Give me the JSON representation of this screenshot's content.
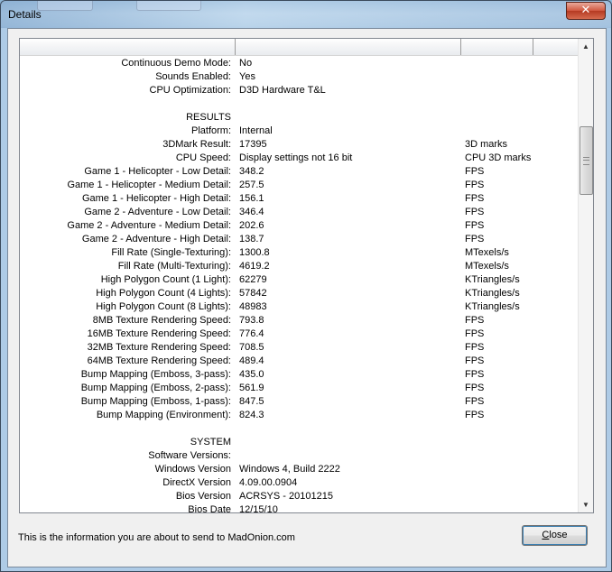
{
  "window": {
    "title": "Details",
    "close_glyph": "✕"
  },
  "list": {
    "rows": [
      {
        "label": "Continuous Demo Mode:",
        "value": "No",
        "unit": ""
      },
      {
        "label": "Sounds Enabled:",
        "value": "Yes",
        "unit": ""
      },
      {
        "label": "CPU Optimization:",
        "value": "D3D Hardware T&L",
        "unit": ""
      },
      {
        "label": "",
        "value": "",
        "unit": ""
      },
      {
        "label": "RESULTS",
        "value": "",
        "unit": ""
      },
      {
        "label": "Platform:",
        "value": "Internal",
        "unit": ""
      },
      {
        "label": "3DMark Result:",
        "value": "17395",
        "unit": "3D marks"
      },
      {
        "label": "CPU Speed:",
        "value": "Display settings not 16 bit",
        "unit": "CPU 3D marks"
      },
      {
        "label": "Game 1 - Helicopter - Low Detail:",
        "value": "348.2",
        "unit": "FPS"
      },
      {
        "label": "Game 1 - Helicopter - Medium Detail:",
        "value": "257.5",
        "unit": "FPS"
      },
      {
        "label": "Game 1 - Helicopter - High Detail:",
        "value": "156.1",
        "unit": "FPS"
      },
      {
        "label": "Game 2 - Adventure - Low Detail:",
        "value": "346.4",
        "unit": "FPS"
      },
      {
        "label": "Game 2 - Adventure - Medium Detail:",
        "value": "202.6",
        "unit": "FPS"
      },
      {
        "label": "Game 2 - Adventure - High Detail:",
        "value": "138.7",
        "unit": "FPS"
      },
      {
        "label": "Fill Rate (Single-Texturing):",
        "value": "1300.8",
        "unit": "MTexels/s"
      },
      {
        "label": "Fill Rate (Multi-Texturing):",
        "value": "4619.2",
        "unit": "MTexels/s"
      },
      {
        "label": "High Polygon Count (1 Light):",
        "value": "62279",
        "unit": "KTriangles/s"
      },
      {
        "label": "High Polygon Count (4 Lights):",
        "value": "57842",
        "unit": "KTriangles/s"
      },
      {
        "label": "High Polygon Count (8 Lights):",
        "value": "48983",
        "unit": "KTriangles/s"
      },
      {
        "label": "8MB Texture Rendering Speed:",
        "value": "793.8",
        "unit": "FPS"
      },
      {
        "label": "16MB Texture Rendering Speed:",
        "value": "776.4",
        "unit": "FPS"
      },
      {
        "label": "32MB Texture Rendering Speed:",
        "value": "708.5",
        "unit": "FPS"
      },
      {
        "label": "64MB Texture Rendering Speed:",
        "value": "489.4",
        "unit": "FPS"
      },
      {
        "label": "Bump Mapping (Emboss, 3-pass):",
        "value": "435.0",
        "unit": "FPS"
      },
      {
        "label": "Bump Mapping (Emboss, 2-pass):",
        "value": "561.9",
        "unit": "FPS"
      },
      {
        "label": "Bump Mapping (Emboss, 1-pass):",
        "value": "847.5",
        "unit": "FPS"
      },
      {
        "label": "Bump Mapping (Environment):",
        "value": "824.3",
        "unit": "FPS"
      },
      {
        "label": "",
        "value": "",
        "unit": ""
      },
      {
        "label": "SYSTEM",
        "value": "",
        "unit": ""
      },
      {
        "label": "Software Versions:",
        "value": "",
        "unit": ""
      },
      {
        "label": "Windows Version",
        "value": "Windows 4, Build 2222",
        "unit": ""
      },
      {
        "label": "DirectX Version",
        "value": "4.09.00.0904",
        "unit": ""
      },
      {
        "label": "Bios Version",
        "value": "ACRSYS - 20101215",
        "unit": ""
      },
      {
        "label": "Bios Date",
        "value": "12/15/10",
        "unit": ""
      }
    ]
  },
  "scrollbar": {
    "up_glyph": "▲",
    "down_glyph": "▼"
  },
  "footer": {
    "info_text": "This is the information you are about to send to MadOnion.com",
    "close_button_label": "Close",
    "close_accelerator": "C",
    "close_rest": "lose"
  }
}
